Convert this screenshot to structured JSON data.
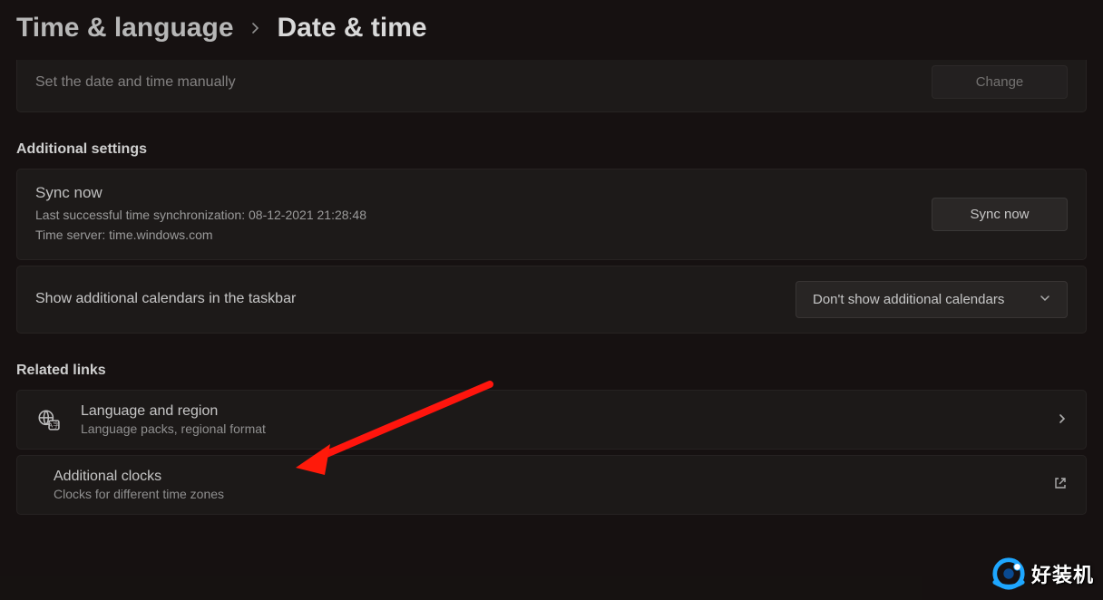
{
  "breadcrumb": {
    "parent": "Time & language",
    "current": "Date & time"
  },
  "manual": {
    "label": "Set the date and time manually",
    "button": "Change"
  },
  "sections": {
    "additional_settings": "Additional settings",
    "related_links": "Related links"
  },
  "sync": {
    "title": "Sync now",
    "last_line": "Last successful time synchronization: 08-12-2021 21:28:48",
    "server_line": "Time server: time.windows.com",
    "button": "Sync now"
  },
  "calendars": {
    "label": "Show additional calendars in the taskbar",
    "value": "Don't show additional calendars"
  },
  "links": {
    "language": {
      "title": "Language and region",
      "sub": "Language packs, regional format"
    },
    "clocks": {
      "title": "Additional clocks",
      "sub": "Clocks for different time zones"
    }
  },
  "watermark": "好装机"
}
